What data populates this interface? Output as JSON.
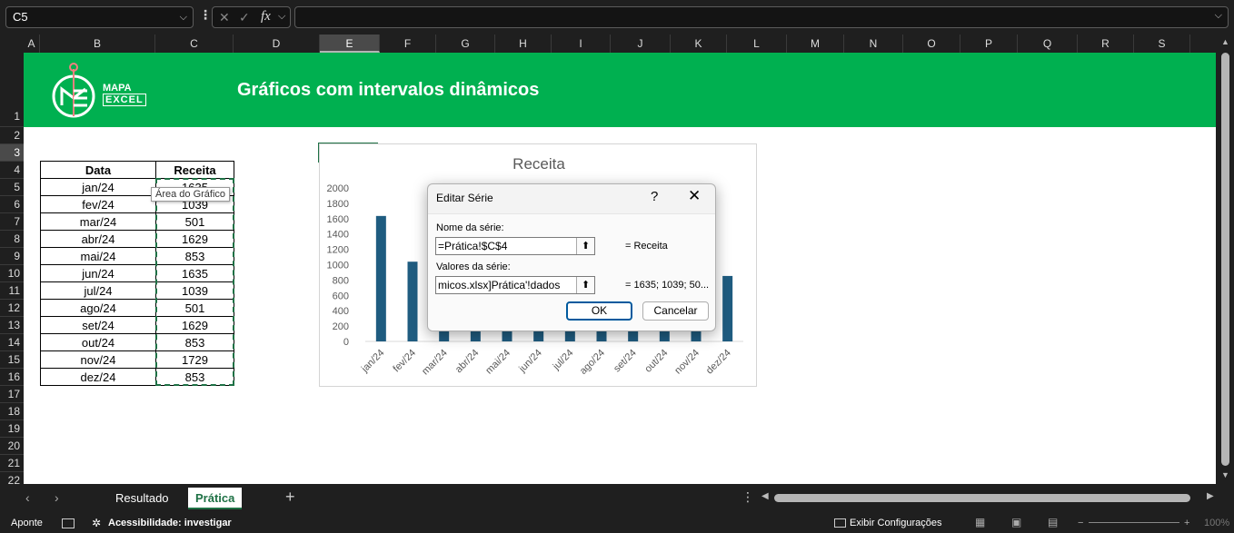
{
  "formula_bar": {
    "name_box": "C5",
    "cancel_icon": "✕",
    "confirm_icon": "✓",
    "fx_label": "fx",
    "formula": ""
  },
  "columns": [
    "A",
    "B",
    "C",
    "D",
    "E",
    "F",
    "G",
    "H",
    "I",
    "J",
    "K",
    "L",
    "M",
    "N",
    "O",
    "P",
    "Q",
    "R",
    "S"
  ],
  "selected_column": "E",
  "rows": [
    "1",
    "2",
    "3",
    "4",
    "5",
    "6",
    "7",
    "8",
    "9",
    "10",
    "11",
    "12",
    "13",
    "14",
    "15",
    "16",
    "17",
    "18",
    "19",
    "20",
    "21",
    "22"
  ],
  "selected_row": "3",
  "banner": {
    "title": "Gráficos com intervalos dinâmicos",
    "logo_line1": "MAPA",
    "logo_line2": "EXCEL"
  },
  "table": {
    "headers": [
      "Data",
      "Receita"
    ],
    "rows": [
      [
        "jan/24",
        "1635"
      ],
      [
        "fev/24",
        "1039"
      ],
      [
        "mar/24",
        "501"
      ],
      [
        "abr/24",
        "1629"
      ],
      [
        "mai/24",
        "853"
      ],
      [
        "jun/24",
        "1635"
      ],
      [
        "jul/24",
        "1039"
      ],
      [
        "ago/24",
        "501"
      ],
      [
        "set/24",
        "1629"
      ],
      [
        "out/24",
        "853"
      ],
      [
        "nov/24",
        "1729"
      ],
      [
        "dez/24",
        "853"
      ]
    ]
  },
  "tooltip": "Área do Gráfico",
  "chart_data": {
    "type": "bar",
    "title": "Receita",
    "categories": [
      "jan/24",
      "fev/24",
      "mar/24",
      "abr/24",
      "mai/24",
      "jun/24",
      "jul/24",
      "ago/24",
      "set/24",
      "out/24",
      "nov/24",
      "dez/24"
    ],
    "values": [
      1635,
      1039,
      501,
      1629,
      853,
      1635,
      1039,
      501,
      1629,
      853,
      1729,
      853
    ],
    "yticks": [
      0,
      200,
      400,
      600,
      800,
      1000,
      1200,
      1400,
      1600,
      1800,
      2000
    ],
    "ylim": [
      0,
      2000
    ],
    "color": "#1f5c80"
  },
  "dialog": {
    "title": "Editar Série",
    "help": "?",
    "close": "✕",
    "series_name_label": "Nome da série:",
    "series_name_value": "=Prática!$C$4",
    "series_name_result": "= Receita",
    "series_values_label": "Valores da série:",
    "series_values_value": "micos.xlsx]Prática'!dados",
    "series_values_result": "= 1635; 1039; 50...",
    "ok": "OK",
    "cancel": "Cancelar"
  },
  "sheet_tabs": {
    "tabs": [
      "Resultado",
      "Prática"
    ],
    "active": "Prática"
  },
  "status": {
    "mode": "Aponte",
    "accessibility": "Acessibilidade: investigar",
    "display_settings": "Exibir Configurações",
    "zoom": "100%"
  }
}
